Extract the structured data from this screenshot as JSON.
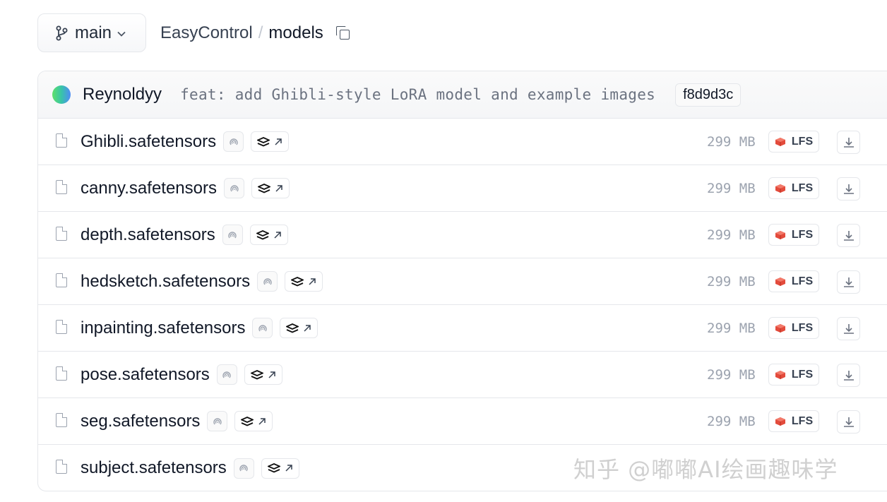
{
  "branch": {
    "label": "main"
  },
  "breadcrumb": {
    "repo": "EasyControl",
    "separator": "/",
    "folder": "models"
  },
  "commit": {
    "author": "Reynoldyy",
    "message": "feat: add Ghibli-style LoRA model and example images",
    "hash": "f8d9d3c"
  },
  "files": [
    {
      "name": "Ghibli.safetensors",
      "size": "299 MB",
      "lfs": "LFS",
      "has_lfs": true
    },
    {
      "name": "canny.safetensors",
      "size": "299 MB",
      "lfs": "LFS",
      "has_lfs": true
    },
    {
      "name": "depth.safetensors",
      "size": "299 MB",
      "lfs": "LFS",
      "has_lfs": true
    },
    {
      "name": "hedsketch.safetensors",
      "size": "299 MB",
      "lfs": "LFS",
      "has_lfs": true
    },
    {
      "name": "inpainting.safetensors",
      "size": "299 MB",
      "lfs": "LFS",
      "has_lfs": true
    },
    {
      "name": "pose.safetensors",
      "size": "299 MB",
      "lfs": "LFS",
      "has_lfs": true
    },
    {
      "name": "seg.safetensors",
      "size": "299 MB",
      "lfs": "LFS",
      "has_lfs": true
    },
    {
      "name": "subject.safetensors",
      "size": "",
      "lfs": "",
      "has_lfs": false
    }
  ],
  "watermark": "知乎 @嘟嘟AI绘画趣味学",
  "icons": {
    "branch": "git-branch-icon",
    "copy": "copy-icon",
    "file": "file-icon",
    "scan": "security-scan-icon",
    "explore": "layers-arrow-icon",
    "lfs": "lfs-cube-icon",
    "download": "download-icon"
  },
  "colors": {
    "lfs_cube": "#e34b3c",
    "size_text": "#9ca3af",
    "border": "#e5e7eb"
  }
}
